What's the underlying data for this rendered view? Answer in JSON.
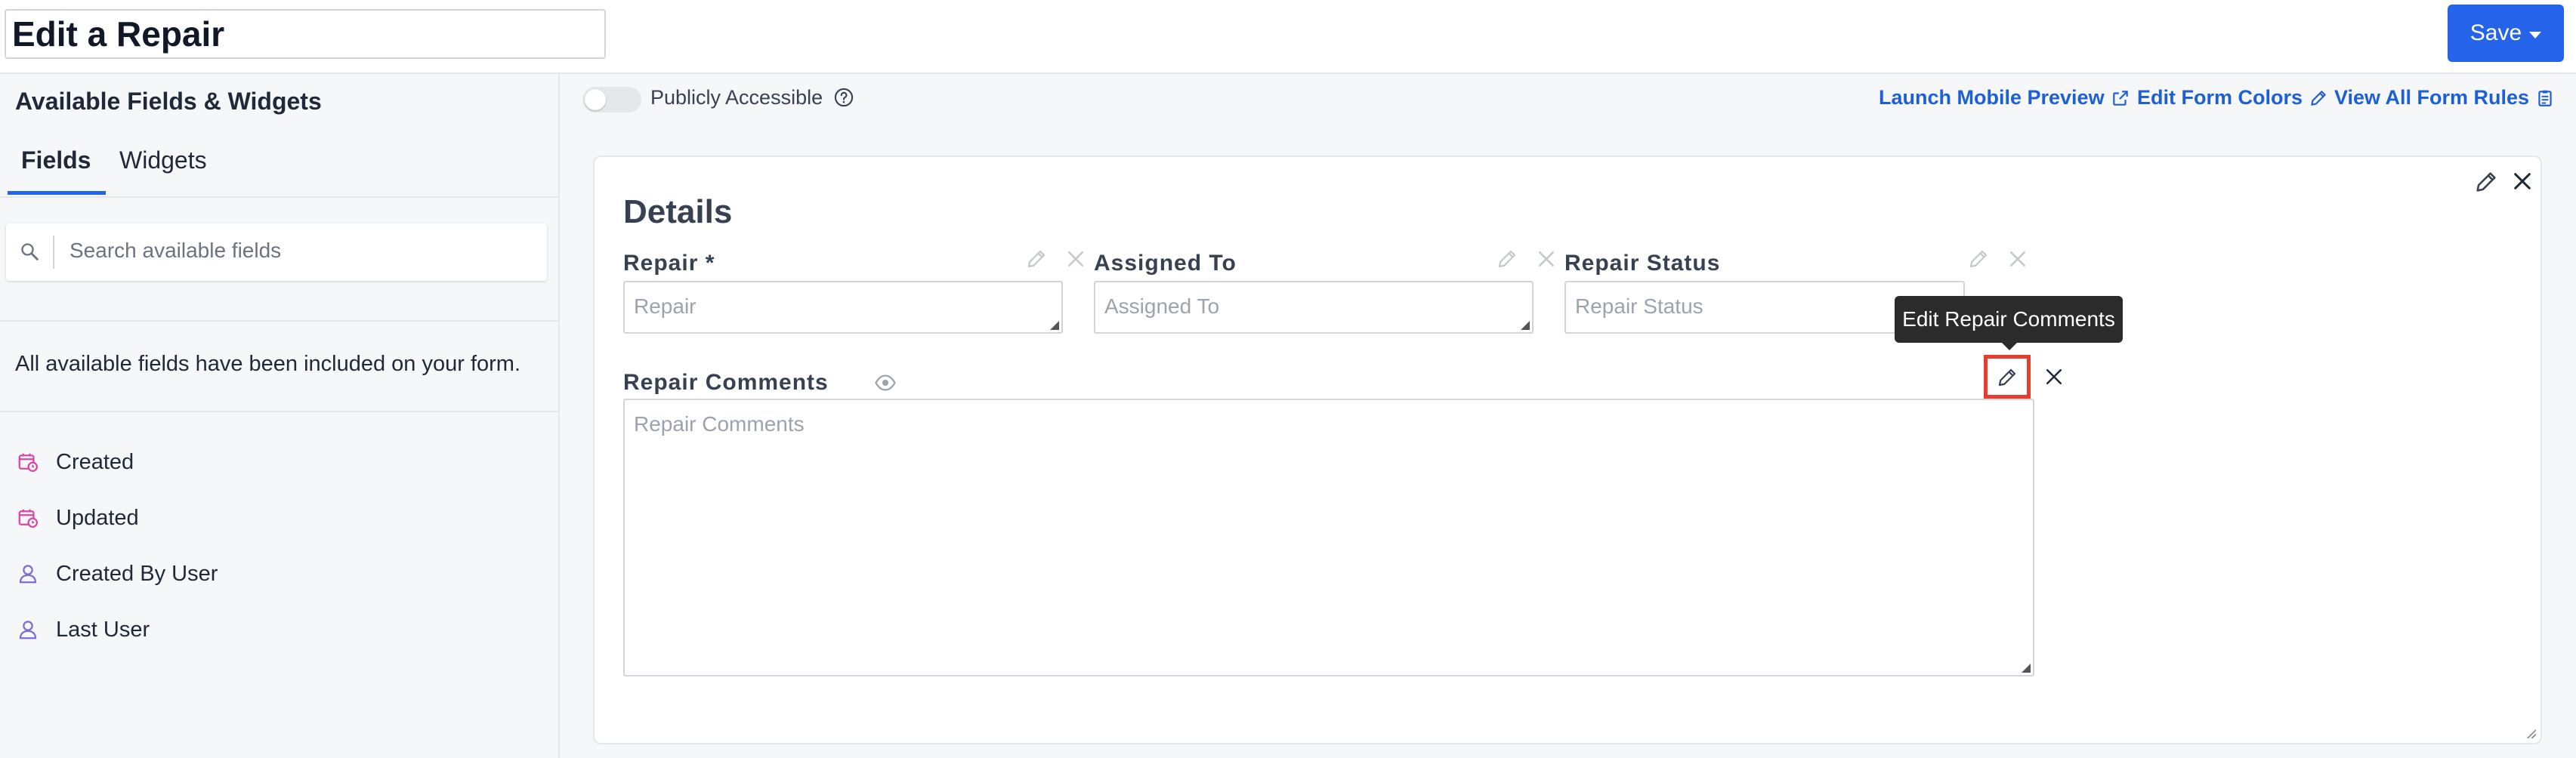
{
  "header": {
    "title": "Edit a Repair",
    "save_label": "Save"
  },
  "sidebar": {
    "title": "Available Fields & Widgets",
    "tabs": [
      {
        "label": "Fields",
        "active": true
      },
      {
        "label": "Widgets",
        "active": false
      }
    ],
    "search_placeholder": "Search available fields",
    "info_text": "All available fields have been included on your form.",
    "items": [
      {
        "label": "Created",
        "icon": "calendar-clock-icon"
      },
      {
        "label": "Updated",
        "icon": "calendar-clock-icon"
      },
      {
        "label": "Created By User",
        "icon": "user-icon"
      },
      {
        "label": "Last User",
        "icon": "user-icon"
      }
    ]
  },
  "toolbar": {
    "public_label": "Publicly Accessible",
    "public_enabled": false,
    "links": [
      {
        "label": "Launch Mobile Preview",
        "icon": "external-link-icon"
      },
      {
        "label": "Edit Form Colors",
        "icon": "pencil-icon"
      },
      {
        "label": "View All Form Rules",
        "icon": "clipboard-icon"
      }
    ]
  },
  "form": {
    "section_title": "Details",
    "fields": [
      {
        "label": "Repair *",
        "placeholder": "Repair"
      },
      {
        "label": "Assigned To",
        "placeholder": "Assigned To"
      },
      {
        "label": "Repair Status",
        "placeholder": "Repair Status"
      }
    ],
    "comments": {
      "label": "Repair Comments",
      "placeholder": "Repair Comments"
    },
    "tooltip": "Edit Repair Comments"
  },
  "colors": {
    "accent": "#2563eb",
    "link": "#1d5fd6",
    "highlight": "#e53e2f",
    "date_icon": "#d946a8",
    "user_icon": "#7c6cd6"
  }
}
